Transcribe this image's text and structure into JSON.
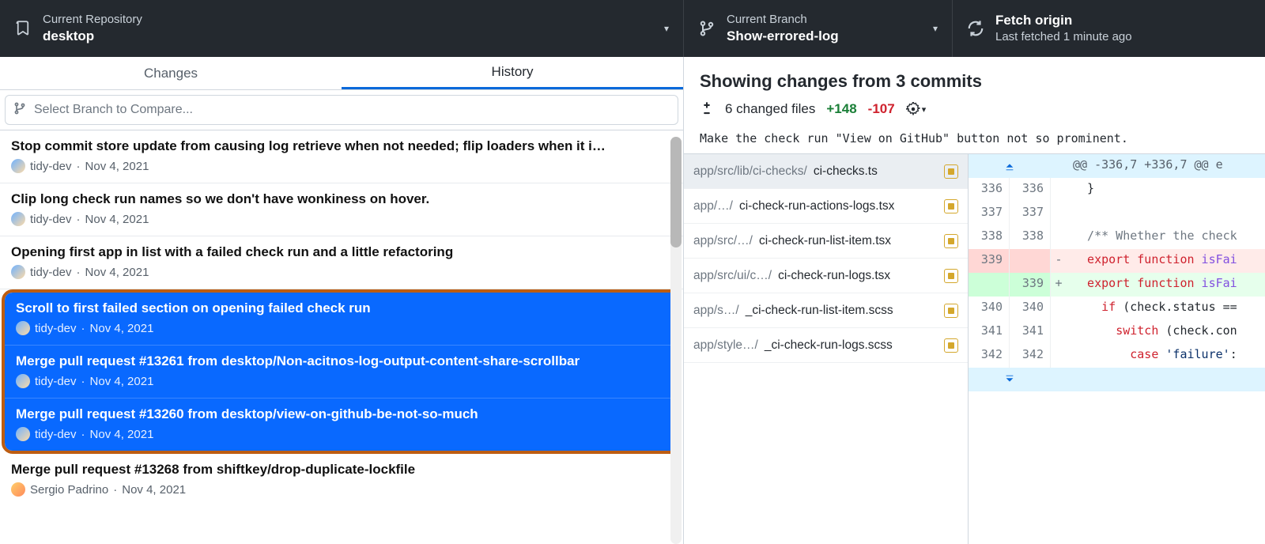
{
  "toolbar": {
    "repo_label": "Current Repository",
    "repo_name": "desktop",
    "branch_label": "Current Branch",
    "branch_name": "Show-errored-log",
    "fetch_label": "Fetch origin",
    "fetch_status": "Last fetched 1 minute ago"
  },
  "tabs": {
    "changes": "Changes",
    "history": "History"
  },
  "compare_placeholder": "Select Branch to Compare...",
  "commits": [
    {
      "title": "Stop commit store update from causing log retrieve when not needed; flip loaders when it i…",
      "author": "tidy-dev",
      "date": "Nov 4, 2021",
      "avatar": "tidy"
    },
    {
      "title": "Clip long check run names so we don't have wonkiness on hover.",
      "author": "tidy-dev",
      "date": "Nov 4, 2021",
      "avatar": "tidy"
    },
    {
      "title": "Opening first app in list with a failed check run and a little refactoring",
      "author": "tidy-dev",
      "date": "Nov 4, 2021",
      "avatar": "tidy"
    },
    {
      "title": "Scroll to first failed section on opening failed check run",
      "author": "tidy-dev",
      "date": "Nov 4, 2021",
      "avatar": "tidy"
    },
    {
      "title": "Merge pull request #13261 from desktop/Non-acitnos-log-output-content-share-scrollbar",
      "author": "tidy-dev",
      "date": "Nov 4, 2021",
      "avatar": "tidy"
    },
    {
      "title": "Merge pull request #13260 from desktop/view-on-github-be-not-so-much",
      "author": "tidy-dev",
      "date": "Nov 4, 2021",
      "avatar": "tidy"
    },
    {
      "title": "Merge pull request #13268 from shiftkey/drop-duplicate-lockfile",
      "author": "Sergio Padrino",
      "date": "Nov 4, 2021",
      "avatar": "sergio"
    }
  ],
  "detail": {
    "header": "Showing changes from 3 commits",
    "changed_files": "6 changed files",
    "additions": "+148",
    "deletions": "-107",
    "message": "Make the check run \"View on GitHub\" button not so prominent."
  },
  "files": [
    {
      "dim": "app/src/lib/ci-checks/",
      "name": "ci-checks.ts"
    },
    {
      "dim": "app/…/",
      "name": "ci-check-run-actions-logs.tsx"
    },
    {
      "dim": "app/src/…/",
      "name": "ci-check-run-list-item.tsx"
    },
    {
      "dim": "app/src/ui/c…/",
      "name": "ci-check-run-logs.tsx"
    },
    {
      "dim": "app/s…/",
      "name": "_ci-check-run-list-item.scss"
    },
    {
      "dim": "app/style…/",
      "name": "_ci-check-run-logs.scss"
    }
  ],
  "diff": {
    "hunk": "@@ -336,7 +336,7 @@ e",
    "rows": [
      {
        "l": "336",
        "r": "336",
        "sign": " ",
        "code": "  }"
      },
      {
        "l": "337",
        "r": "337",
        "sign": " ",
        "code": ""
      },
      {
        "l": "338",
        "r": "338",
        "sign": " ",
        "com": "  /** Whether the check"
      },
      {
        "l": "339",
        "r": "",
        "sign": "-",
        "removed": true,
        "kw": "  export function",
        "rest": " isFai"
      },
      {
        "l": "",
        "r": "339",
        "sign": "+",
        "added": true,
        "kw": "  export function",
        "rest": " isFai"
      },
      {
        "l": "340",
        "r": "340",
        "sign": " ",
        "if": true
      },
      {
        "l": "341",
        "r": "341",
        "sign": " ",
        "switch": true
      },
      {
        "l": "342",
        "r": "342",
        "sign": " ",
        "case": true
      }
    ]
  }
}
